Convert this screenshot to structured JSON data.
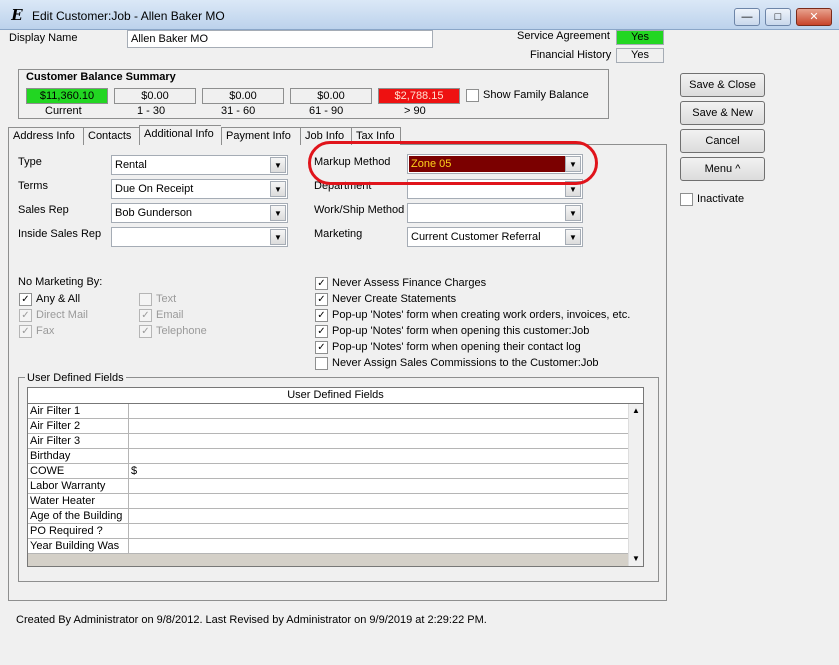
{
  "window": {
    "icon": "E",
    "title": "Edit Customer:Job - Allen Baker MO",
    "minimize_icon": "minimize-icon",
    "maximize_icon": "maximize-icon",
    "close_icon": "close-icon"
  },
  "header": {
    "display_name_label": "Display Name",
    "display_name_value": "Allen Baker MO",
    "service_agreement_label": "Service Agreement",
    "service_agreement_value": "Yes",
    "financial_history_label": "Financial History",
    "financial_history_value": "Yes",
    "colors": {
      "service_agreement_bg": "#22d622"
    }
  },
  "balance": {
    "title": "Customer Balance Summary",
    "buckets": [
      {
        "amount": "$11,360.10",
        "label": "Current",
        "bg": "#22d622"
      },
      {
        "amount": "$0.00",
        "label": "1 - 30",
        "bg": "#f0f0f0"
      },
      {
        "amount": "$0.00",
        "label": "31 - 60",
        "bg": "#f0f0f0"
      },
      {
        "amount": "$0.00",
        "label": "61 - 90",
        "bg": "#f0f0f0"
      },
      {
        "amount": "$2,788.15",
        "label": "> 90",
        "bg": "#ee1111"
      }
    ],
    "show_family_balance": "Show Family Balance"
  },
  "tabs": [
    "Address Info",
    "Contacts",
    "Additional Info",
    "Payment Info",
    "Job Info",
    "Tax Info"
  ],
  "fields": {
    "type_label": "Type",
    "type_value": "Rental",
    "terms_label": "Terms",
    "terms_value": "Due On Receipt",
    "sales_rep_label": "Sales Rep",
    "sales_rep_value": "Bob Gunderson",
    "inside_sales_rep_label": "Inside Sales Rep",
    "inside_sales_rep_value": "",
    "markup_method_label": "Markup Method",
    "markup_method_value": "Zone 05",
    "department_label": "Department",
    "department_value": "",
    "job_ship_method_label": "Work/Ship Method",
    "job_ship_method_value": "",
    "marketing_label": "Marketing",
    "marketing_value": "Current Customer Referral"
  },
  "no_marketing": {
    "label": "No Marketing By:",
    "options": [
      {
        "label": "Any & All",
        "checked": true,
        "enabled": true
      },
      {
        "label": "Direct Mail",
        "checked": true,
        "enabled": false
      },
      {
        "label": "Fax",
        "checked": true,
        "enabled": false
      },
      {
        "label": "Text",
        "checked": false,
        "enabled": false
      },
      {
        "label": "Email",
        "checked": true,
        "enabled": false
      },
      {
        "label": "Telephone",
        "checked": true,
        "enabled": false
      }
    ]
  },
  "options": [
    {
      "label": "Never Assess Finance Charges",
      "checked": true
    },
    {
      "label": "Never Create Statements",
      "checked": true
    },
    {
      "label": "Pop-up 'Notes' form when creating work orders, invoices, etc.",
      "checked": true
    },
    {
      "label": "Pop-up 'Notes' form when opening this customer:Job",
      "checked": true
    },
    {
      "label": "Pop-up 'Notes' form when opening their contact log",
      "checked": true
    },
    {
      "label": "Never Assign Sales Commissions to the Customer:Job",
      "checked": false
    }
  ],
  "udf": {
    "group_label": "User Defined Fields",
    "header": "User Defined Fields",
    "rows": [
      {
        "k": "Air Filter 1",
        "v": ""
      },
      {
        "k": "Air Filter 2",
        "v": ""
      },
      {
        "k": "Air Filter 3",
        "v": ""
      },
      {
        "k": "Birthday",
        "v": ""
      },
      {
        "k": "COWE",
        "v": "$"
      },
      {
        "k": "Labor Warranty",
        "v": ""
      },
      {
        "k": "Water Heater",
        "v": ""
      },
      {
        "k": "Age of the Building",
        "v": ""
      },
      {
        "k": "PO Required ?",
        "v": ""
      },
      {
        "k": "Year Building Was",
        "v": ""
      }
    ]
  },
  "buttons": {
    "save_close": "Save & Close",
    "save_new": "Save & New",
    "cancel": "Cancel",
    "menu": "Menu ^",
    "inactivate": "Inactivate"
  },
  "footer": "Created By Administrator on 9/8/2012.  Last Revised by Administrator on 9/9/2019 at 2:29:22 PM."
}
